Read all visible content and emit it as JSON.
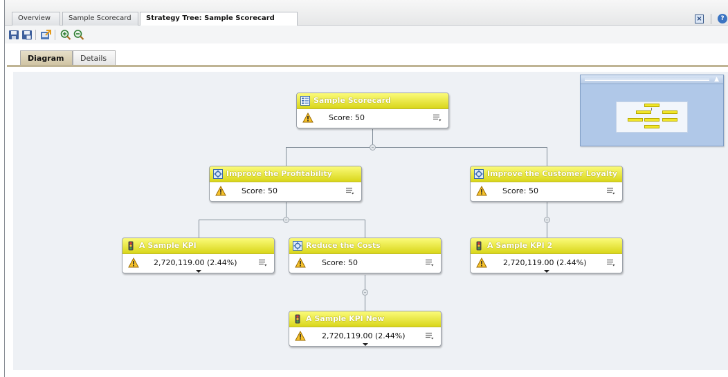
{
  "tabs": [
    {
      "label": "Overview"
    },
    {
      "label": "Sample Scorecard"
    },
    {
      "label": "Strategy Tree: Sample Scorecard"
    }
  ],
  "toolbar": {
    "icons": [
      "save-icon",
      "save-as-icon",
      "export-icon",
      "zoom-in-icon",
      "zoom-out-icon"
    ]
  },
  "view_tabs": [
    {
      "label": "Diagram"
    },
    {
      "label": "Details"
    }
  ],
  "nodes": {
    "root": {
      "title": "Sample Scorecard",
      "value": "Score: 50",
      "icon": "scorecard-icon"
    },
    "profit": {
      "title": "Improve the Profitability",
      "value": "Score: 50",
      "icon": "objective-icon"
    },
    "loyalty": {
      "title": "Improve the Customer Loyalty",
      "value": "Score: 50",
      "icon": "objective-icon"
    },
    "kpi1": {
      "title": "A Sample KPI",
      "value": "2,720,119.00 (2.44%)",
      "icon": "traffic-light-icon"
    },
    "costs": {
      "title": "Reduce the Costs",
      "value": "Score: 50",
      "icon": "objective-icon"
    },
    "kpi2": {
      "title": "A Sample KPI 2",
      "value": "2,720,119.00 (2.44%)",
      "icon": "traffic-light-icon"
    },
    "kpinew": {
      "title": "A Sample KPI New",
      "value": "2,720,119.00 (2.44%)",
      "icon": "traffic-light-icon"
    }
  },
  "colors": {
    "node_header": "#e6e322",
    "canvas": "#eef1f5",
    "active_view_tab": "#d8cdb0"
  }
}
